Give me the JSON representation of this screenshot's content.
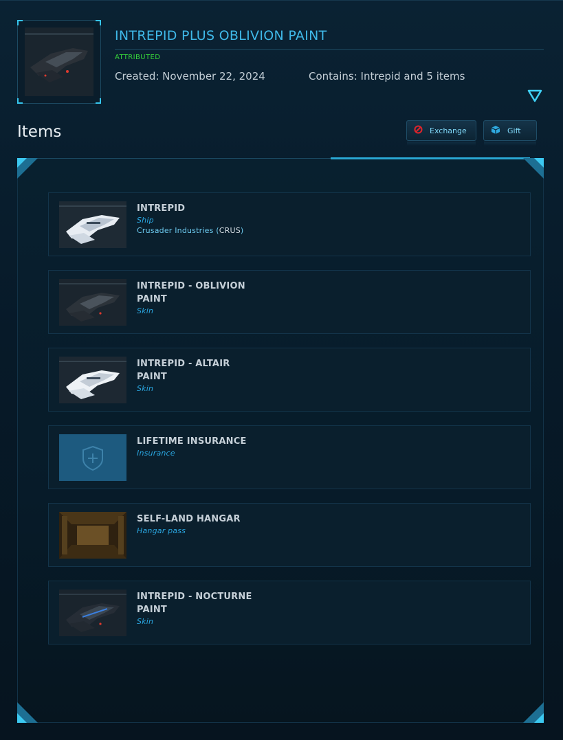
{
  "pledge": {
    "title": "INTREPID PLUS OBLIVION PAINT",
    "status": "ATTRIBUTED",
    "created": "Created: November 22, 2024",
    "contains": "Contains: Intrepid and 5 items"
  },
  "items_section": {
    "heading": "Items",
    "exchange_label": "Exchange",
    "gift_label": "Gift"
  },
  "items": [
    {
      "name": "INTREPID",
      "type": "Ship",
      "maker": "Crusader Industries",
      "maker_code": "CRUS"
    },
    {
      "name": "INTREPID - OBLIVION PAINT",
      "type": "Skin"
    },
    {
      "name": "INTREPID - ALTAIR PAINT",
      "type": "Skin"
    },
    {
      "name": "LIFETIME INSURANCE",
      "type": "Insurance"
    },
    {
      "name": "SELF-LAND HANGAR",
      "type": "Hangar pass"
    },
    {
      "name": "INTREPID - NOCTURNE PAINT",
      "type": "Skin"
    }
  ],
  "colors": {
    "accent": "#3fb8e8",
    "attributed": "#37d43a",
    "item_type": "#2aa6e0",
    "exchange_icon": "#e0242b"
  },
  "icons": [
    "dropdown-chevron-icon",
    "no-entry-icon",
    "gift-cube-icon",
    "shield-plus-icon"
  ]
}
